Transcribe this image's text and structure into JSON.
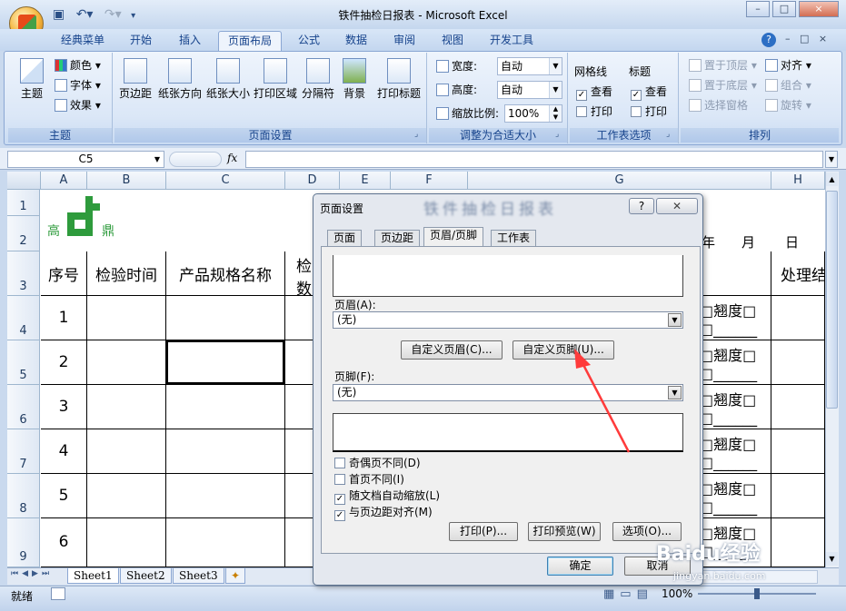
{
  "window": {
    "title": "铁件抽检日报表 - Microsoft Excel",
    "qat_icons": [
      "save-icon",
      "undo-icon",
      "redo-icon"
    ],
    "controls": [
      "–",
      "□",
      "×"
    ]
  },
  "ribbon_tabs": [
    "经典菜单",
    "开始",
    "插入",
    "页面布局",
    "公式",
    "数据",
    "审阅",
    "视图",
    "开发工具"
  ],
  "active_tab": "页面布局",
  "ribbon": {
    "themes": {
      "label": "主题",
      "theme_btn": "主题",
      "colors": "颜色",
      "fonts": "字体",
      "effects": "效果"
    },
    "page_setup": {
      "label": "页面设置",
      "buttons": [
        "页边距",
        "纸张方向",
        "纸张大小",
        "打印区域",
        "分隔符",
        "背景",
        "打印标题"
      ]
    },
    "scale": {
      "label": "调整为合适大小",
      "width_label": "宽度:",
      "width_value": "自动",
      "height_label": "高度:",
      "height_value": "自动",
      "scale_label": "缩放比例:",
      "scale_value": "100%"
    },
    "sheet_options": {
      "label": "工作表选项",
      "gridlines": "网格线",
      "headings": "标题",
      "view": "查看",
      "print": "打印",
      "gridlines_view": true,
      "headings_view": true
    },
    "arrange": {
      "label": "排列",
      "items": [
        "置于顶层",
        "置于底层",
        "选择窗格",
        "对齐",
        "组合",
        "旋转"
      ]
    }
  },
  "formula_bar": {
    "name_box": "C5",
    "fx": "fx",
    "formula": ""
  },
  "columns": [
    "A",
    "B",
    "C",
    "D",
    "E",
    "F",
    "G",
    "H"
  ],
  "rows": [
    "1",
    "2",
    "3",
    "4",
    "5",
    "6",
    "7",
    "8",
    "9"
  ],
  "sheet": {
    "logo_left": "高",
    "logo_right": "鼎",
    "headers": [
      "序号",
      "检验时间",
      "产品规格名称",
      "检",
      "数",
      "处理结"
    ],
    "date_labels": [
      "年",
      "月",
      "日"
    ],
    "row_numbers": [
      "1",
      "2",
      "3",
      "4",
      "5",
      "6"
    ],
    "right_cell_text": "□翘度□",
    "right_cell_text2": "□______"
  },
  "sheet_tabs": [
    "Sheet1",
    "Sheet2",
    "Sheet3"
  ],
  "status": {
    "ready": "就绪",
    "zoom": "100%"
  },
  "dialog": {
    "title": "页面设置",
    "title_blurred": "铁件抽检日报表",
    "help": "?",
    "close": "✕",
    "tabs": [
      "页面",
      "页边距",
      "页眉/页脚",
      "工作表"
    ],
    "active_tab": "页眉/页脚",
    "header_label": "页眉(A):",
    "header_value": "(无)",
    "custom_header": "自定义页眉(C)...",
    "custom_footer": "自定义页脚(U)...",
    "footer_label": "页脚(F):",
    "footer_value": "(无)",
    "options": [
      {
        "label": "奇偶页不同(D)",
        "checked": false
      },
      {
        "label": "首页不同(I)",
        "checked": false
      },
      {
        "label": "随文档自动缩放(L)",
        "checked": true
      },
      {
        "label": "与页边距对齐(M)",
        "checked": true
      }
    ],
    "print": "打印(P)...",
    "print_preview": "打印预览(W)",
    "options_btn": "选项(O)...",
    "ok": "确定",
    "cancel": "取消"
  },
  "watermark": {
    "text": "Baidu经验",
    "url": "jingyan.baidu.com"
  },
  "colors": {
    "accent": "#15428b",
    "arrow": "#ff3b3b",
    "logo": "#2e9b3c"
  }
}
